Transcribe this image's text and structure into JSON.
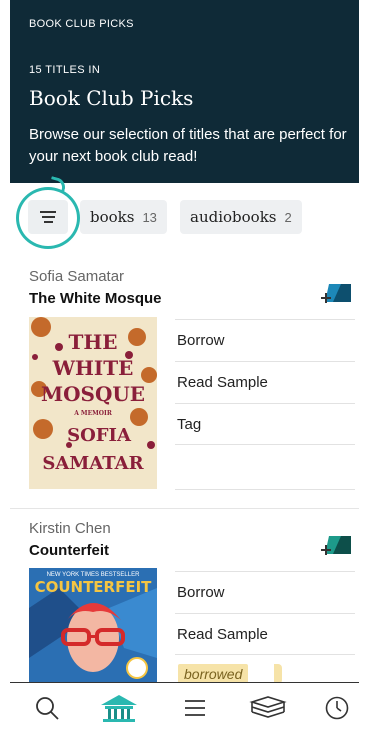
{
  "header": {
    "section_label": "BOOK CLUB PICKS",
    "count_label": "15 TITLES IN",
    "title": "Book Club Picks",
    "description": "Browse our selection of titles that are perfect for your next book club read!",
    "background": "#0f2a37"
  },
  "filters": {
    "filter_icon": "filter-lines-icon",
    "chips": [
      {
        "label": "books",
        "count": "13"
      },
      {
        "label": "audiobooks",
        "count": "2"
      }
    ]
  },
  "books": [
    {
      "author": "Sofia Samatar",
      "title": "The White Mosque",
      "cover_text": [
        "THE",
        "WHITE",
        "MOSQUE",
        "A MEMOIR",
        "SOFIA",
        "SAMATAR"
      ],
      "actions": [
        "Borrow",
        "Read Sample",
        "Tag"
      ]
    },
    {
      "author": "Kirstin Chen",
      "title": "Counterfeit",
      "cover_text": [
        "NEW YORK TIMES BESTSELLER",
        "COUNTERFEIT"
      ],
      "actions": [
        "Borrow",
        "Read Sample"
      ],
      "badge": "borrowed"
    }
  ],
  "nav": [
    {
      "name": "search-icon"
    },
    {
      "name": "library-icon"
    },
    {
      "name": "menu-icon"
    },
    {
      "name": "shelf-icon"
    },
    {
      "name": "history-icon"
    }
  ],
  "colors": {
    "accent": "#2ab8b0",
    "tag": "#1d88b8"
  }
}
